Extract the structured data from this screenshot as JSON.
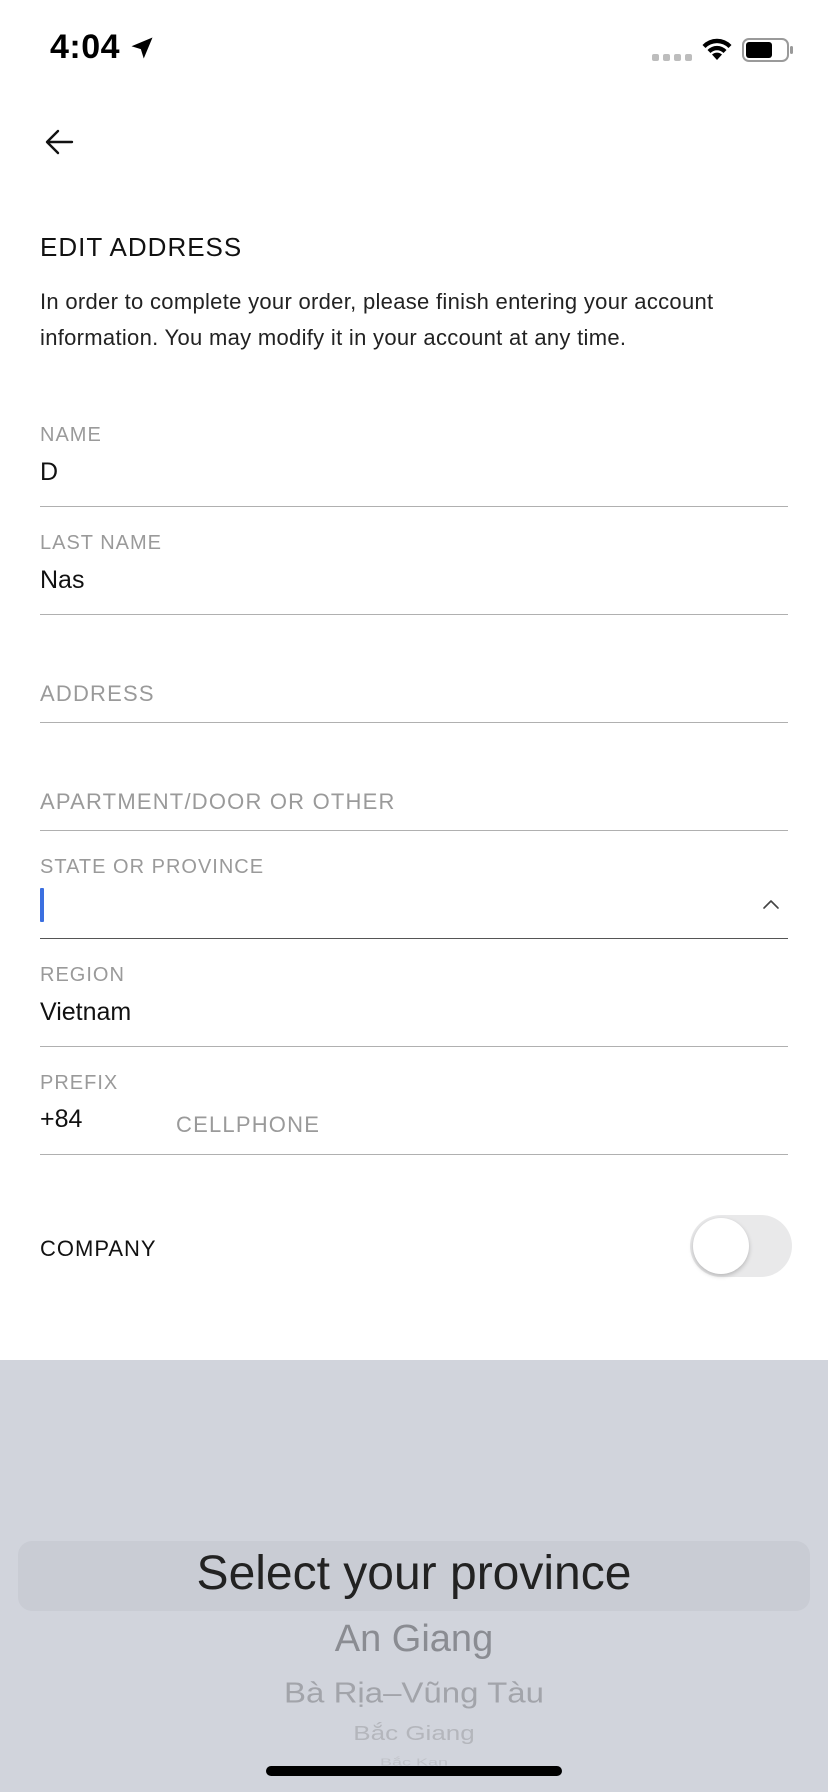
{
  "status_bar": {
    "time": "4:04"
  },
  "header": {
    "title": "EDIT ADDRESS",
    "intro": "In order to complete your order, please finish entering your account information. You may modify it in your account at any time."
  },
  "form": {
    "name": {
      "label": "NAME",
      "value": "D"
    },
    "last_name": {
      "label": "LAST NAME",
      "value": "Nas"
    },
    "address": {
      "placeholder": "ADDRESS"
    },
    "apartment": {
      "placeholder": "APARTMENT/DOOR OR OTHER"
    },
    "state": {
      "label": "STATE OR PROVINCE",
      "value": ""
    },
    "region": {
      "label": "REGION",
      "value": "Vietnam"
    },
    "prefix": {
      "label": "PREFIX",
      "value": "+84"
    },
    "cellphone": {
      "placeholder": "CELLPHONE"
    },
    "company": {
      "label": "COMPANY",
      "enabled": false
    }
  },
  "picker": {
    "selected": "Select your province",
    "options": [
      "An Giang",
      "Bà Rịa–Vũng Tàu",
      "Bắc Giang",
      "Bắc Kạn"
    ]
  },
  "colors": {
    "caret": "#3b6fe0",
    "picker_bg": "#d1d4dc"
  }
}
